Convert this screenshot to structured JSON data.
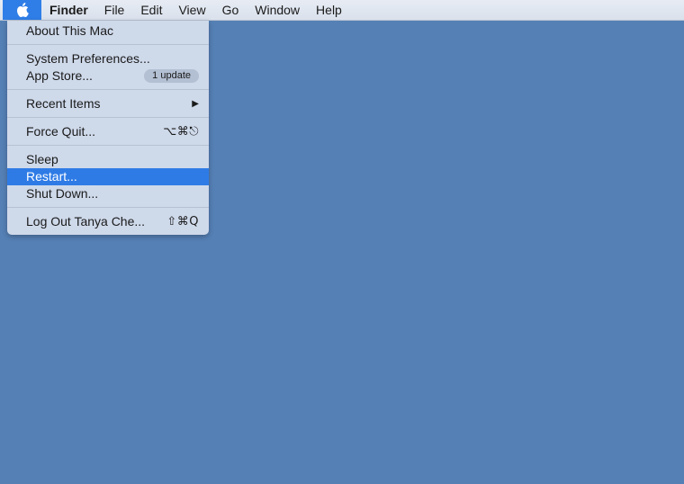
{
  "menubar": {
    "apple_icon": "apple-logo-icon",
    "app_name": "Finder",
    "items": [
      "File",
      "Edit",
      "View",
      "Go",
      "Window",
      "Help"
    ]
  },
  "apple_menu": {
    "about": "About This Mac",
    "system_preferences": "System Preferences...",
    "app_store": "App Store...",
    "app_store_badge": "1 update",
    "recent_items": "Recent Items",
    "recent_items_arrow": "▶",
    "force_quit": "Force Quit...",
    "force_quit_shortcut": "⌥⌘⎋",
    "sleep": "Sleep",
    "restart": "Restart...",
    "shut_down": "Shut Down...",
    "log_out": "Log Out Tanya Che...",
    "log_out_shortcut": "⇧⌘Q",
    "highlighted_item": "Restart..."
  },
  "colors": {
    "desktop": "#5580b5",
    "menubar": "#dae1ec",
    "menu_background": "#ced9ea",
    "highlight": "#2e7be6"
  }
}
